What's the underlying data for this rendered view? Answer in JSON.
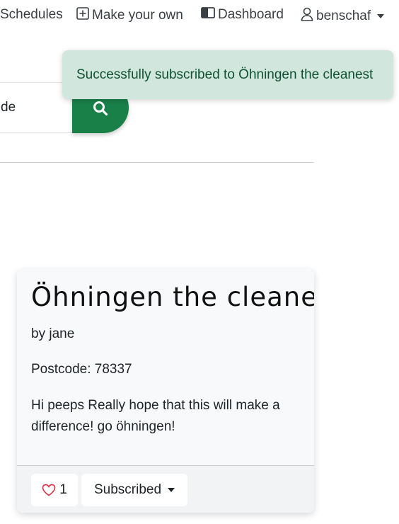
{
  "nav": {
    "schedules_label": "Schedules",
    "make_own_label": "Make your own",
    "dashboard_label": "Dashboard",
    "user_label": "benschaf"
  },
  "toast": {
    "message": "Successfully subscribed to Öhningen the cleanest",
    "color": "#d1e7dd"
  },
  "search": {
    "value": "de",
    "button_color": "#198048"
  },
  "card": {
    "title": "Öhningen the cleanest",
    "author": "by jane",
    "postcode": "Postcode: 78337",
    "description": "Hi peeps Really hope that this will make a difference! go öhningen!",
    "like_count": "1",
    "subscribed_label": "Subscribed"
  },
  "icons": [
    "plus-square-icon",
    "columns-icon",
    "user-icon",
    "caret-down-icon",
    "search-icon",
    "heart-icon"
  ]
}
